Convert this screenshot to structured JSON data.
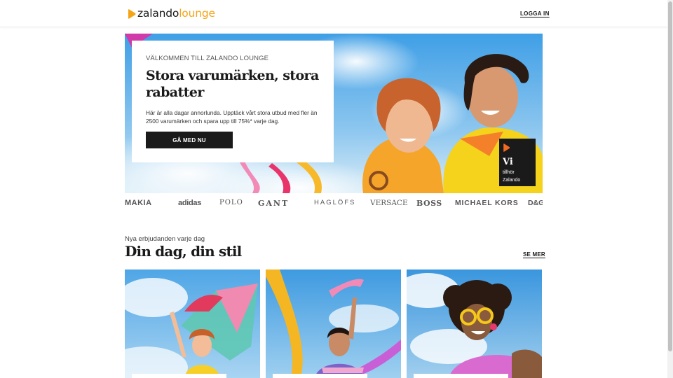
{
  "header": {
    "logo": {
      "part1": "zalando",
      "part2": "lounge"
    },
    "login_label": "LOGGA IN"
  },
  "hero": {
    "eyebrow": "VÄLKOMMEN TILL ZALANDO LOUNGE",
    "title": "Stora varumärken, stora rabatter",
    "description": "Här är alla dagar annorlunda. Upptäck vårt stora utbud med fler än 2500 varumärken och spara upp till 75%* varje dag.",
    "cta_label": "GÅ MED NU",
    "badge": {
      "title": "Vi",
      "line1": "tillhör",
      "line2": "Zalando"
    }
  },
  "brands": [
    "MAKIA",
    "adidas",
    "POLO",
    "GANT",
    "HAGLÖFS",
    "VERSACE",
    "BOSS",
    "MICHAEL KORS",
    "D&G"
  ],
  "section": {
    "subtitle": "Nya erbjudanden varje dag",
    "title": "Din dag, din stil",
    "see_more_label": "SE MER"
  },
  "colors": {
    "brand_orange": "#f5a418",
    "text_dark": "#1a1a1a",
    "sky_blue": "#4aa8e8"
  },
  "icons": [
    "zalando-logo-icon",
    "zalando-badge-icon"
  ]
}
